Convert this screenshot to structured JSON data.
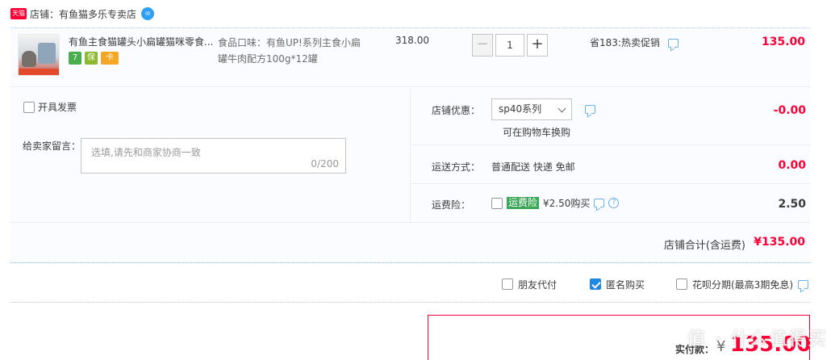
{
  "shop": {
    "badge": "天猫",
    "label": "店铺：有鱼猫多乐专卖店",
    "chat_icon": "wangwang-icon"
  },
  "item": {
    "title": "有鱼主食猫罐头小扁罐猫咪零食...",
    "sku_line1": "食品口味：有鱼UP!系列主食小扁",
    "sku_line2": "罐牛肉配方100g*12罐",
    "unit_price": "318.00",
    "qty_minus": "−",
    "quantity": "1",
    "qty_plus": "+",
    "promo": "省183:热卖促销",
    "subtotal": "135.00",
    "service_icons": [
      "7",
      "保",
      "卡"
    ]
  },
  "invoice": {
    "label": "开具发票",
    "checked": false
  },
  "message": {
    "label": "给卖家留言：",
    "placeholder": "选填,请先和商家协商一致",
    "counter": "0/200"
  },
  "shop_discount": {
    "label": "店铺优惠：",
    "selected": "sp40系列",
    "note": "可在购物车换购",
    "value": "-0.00"
  },
  "shipping": {
    "label": "运送方式：",
    "detail": "普通配送 快递 免邮",
    "value": "0.00"
  },
  "insurance": {
    "label": "运费险：",
    "badge": "运费险",
    "detail": "¥2.50购买",
    "value": "2.50",
    "checked": false
  },
  "shop_total": {
    "label": "店铺合计(含运费)",
    "value": "¥135.00"
  },
  "options": [
    {
      "label": "朋友代付",
      "checked": false
    },
    {
      "label": "匿名购买",
      "checked": true
    },
    {
      "label": "花呗分期(最高3期免息)",
      "checked": false
    }
  ],
  "payment": {
    "label": "实付款：",
    "symbol": "¥",
    "value": "135.00"
  },
  "watermark": "值 · 什么值得买",
  "colors": {
    "accent_red": "#ff0036",
    "link_blue": "#6ab1ea",
    "border_blue": "#b2d1ff"
  }
}
